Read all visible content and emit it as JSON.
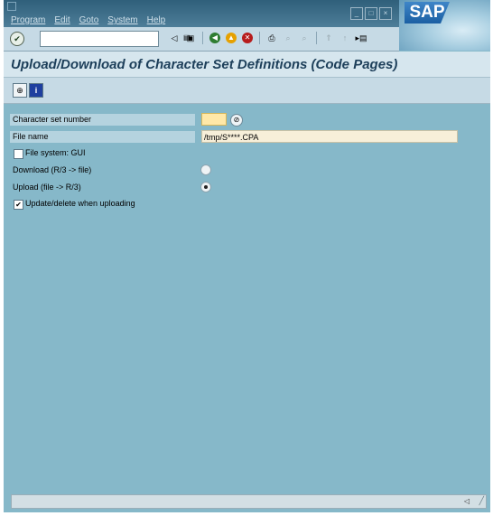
{
  "menubar": {
    "items": [
      "Program",
      "Edit",
      "Goto",
      "System",
      "Help"
    ],
    "brand": "SAP"
  },
  "toolbar": {
    "command_value": "",
    "command_placeholder": ""
  },
  "title": "Upload/Download of Character Set Definitions (Code Pages)",
  "form": {
    "charset_label": "Character set number",
    "charset_value": "",
    "filename_label": "File name",
    "filename_value": "/tmp/S****.CPA",
    "filesystem_label": "File system: GUI",
    "filesystem_checked": false,
    "download_label": "Download (R/3 -> file)",
    "download_selected": false,
    "upload_label": "Upload (file -> R/3)",
    "upload_selected": true,
    "update_label": "Update/delete when uploading",
    "update_checked": true
  },
  "statusbar": {
    "text": ""
  }
}
